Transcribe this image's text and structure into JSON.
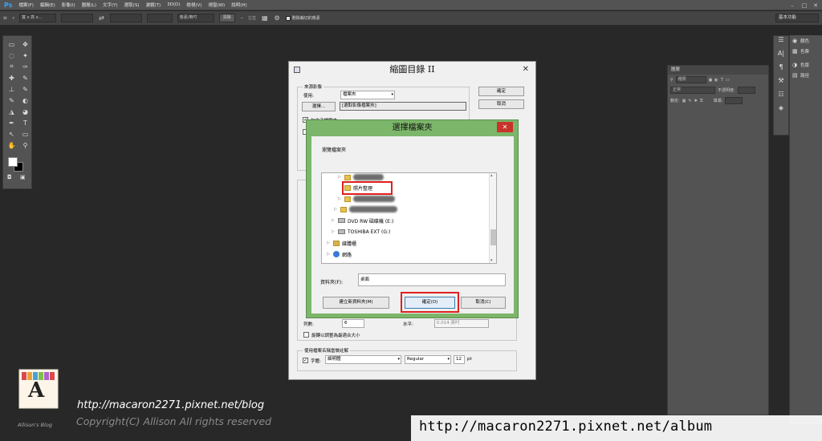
{
  "app": {
    "logo": "Ps",
    "menus": [
      "檔案(F)",
      "編輯(E)",
      "影像(I)",
      "圖層(L)",
      "文字(Y)",
      "選取(S)",
      "濾鏡(T)",
      "3D(D)",
      "檢視(V)",
      "視窗(W)",
      "說明(H)"
    ],
    "window_controls": [
      "–",
      "□",
      "✕"
    ]
  },
  "options_bar": {
    "preset": "寬 x 高 x...",
    "unit": "像素/英吋",
    "clear_label": "清除",
    "straighten_label": "拉直",
    "delete_cropped_label": "刪除裁切的像素",
    "workspace": "基本功能"
  },
  "tools": [
    "▭",
    "✥",
    "◌",
    "✦",
    "⌗",
    "✑",
    "✚",
    "✎",
    "⊥",
    "✎",
    "✎",
    "◐",
    "◮",
    "◕",
    "✒",
    "T",
    "↖",
    "▭",
    "✋",
    "⚲"
  ],
  "right_strip_icons": [
    "☰",
    "A|",
    "¶",
    "⚒",
    "☷",
    "◈"
  ],
  "panels": [
    {
      "icon": "◉",
      "label": "顏色"
    },
    {
      "icon": "▦",
      "label": "色票"
    },
    {
      "icon": "◑",
      "label": "色版"
    },
    {
      "icon": "▤",
      "label": "路徑"
    }
  ],
  "layers_panel": {
    "tab": "圖層",
    "kind_label": "種類",
    "blend_mode": "正常",
    "opacity_label": "不透明度:",
    "lock_label": "鎖定:",
    "fill_label": "填滿:"
  },
  "back_dialog": {
    "title": "縮圖目錄 II",
    "close": "✕",
    "source_group": "來源影像",
    "use_label": "使用:",
    "use_value": "檔案夾",
    "choose_btn": "選擇...",
    "choose_path": "[選取影像檔案夾]",
    "include_sub_label": "包含子檔案夾",
    "ok_btn": "確定",
    "cancel_btn": "取消",
    "columns_label": "列數:",
    "columns_value": "6",
    "horizontal_label": "水平:",
    "horizontal_value": "0.014 英吋",
    "rotate_label": "旋轉以調整為最適合大小",
    "caption_group": "使用檔案名稱當做註解",
    "font_label": "字體:",
    "font_value": "細明體",
    "style_value": "Regular",
    "size_value": "12",
    "size_unit": "pt"
  },
  "front_dialog": {
    "title": "選擇檔案夾",
    "close": "✕",
    "prompt": "瀏覽檔案夾",
    "tree": [
      {
        "label": "",
        "kind": "blur"
      },
      {
        "label": "照片整理",
        "kind": "folder"
      },
      {
        "label": "",
        "kind": "blur"
      },
      {
        "label": "",
        "kind": "blur"
      },
      {
        "label": "DVD RW 磁碟機 (E:)",
        "kind": "drive"
      },
      {
        "label": "TOSHIBA EXT (G:)",
        "kind": "drive"
      },
      {
        "label": "媒體櫃",
        "kind": "library"
      },
      {
        "label": "網路",
        "kind": "network"
      }
    ],
    "folder_label": "資料夾(F):",
    "folder_value": "桌面",
    "new_folder_btn": "建立新資料夾(M)",
    "ok_btn": "確定(O)",
    "cancel_btn": "取消(C)"
  },
  "watermark": {
    "blog_url": "http://macaron2271.pixnet.net/blog",
    "copyright": "Copyright(C) Allison All rights reserved",
    "logo_letter": "A",
    "logo_caption": "Allison's Blog",
    "album_url": "http://macaron2271.pixnet.net/album"
  }
}
